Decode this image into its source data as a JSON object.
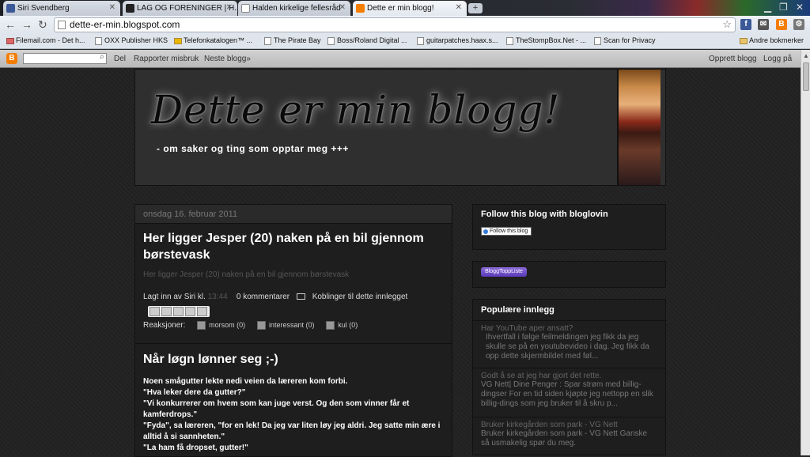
{
  "tabs": [
    {
      "label": "Siri Svendberg",
      "fav": "#3b5998"
    },
    {
      "label": "LAG OG FORENINGER | H...",
      "fav": "#222"
    },
    {
      "label": "Halden kirkelige fellesråd",
      "fav": "#fff"
    },
    {
      "label": "Dette er min blogg!",
      "fav": "#f57d00"
    }
  ],
  "address": "dette-er-min.blogspot.com",
  "bookmarks": [
    "Filemail.com - Det h...",
    "OXX Publisher HKS",
    "Telefonkatalogen™ ...",
    "The Pirate Bay",
    "Boss/Roland Digital ...",
    "guitarpatches.haax.s...",
    "TheStompBox.Net - ...",
    "Scan for Privacy"
  ],
  "other_bookmarks": "Andre bokmerker",
  "navbar": {
    "share": "Del",
    "report": "Rapporter misbruk",
    "next": "Neste blogg»",
    "create": "Opprett blogg",
    "login": "Logg på"
  },
  "header": {
    "title": "Dette er min blogg!",
    "description": "- om saker og ting som opptar meg +++"
  },
  "post": {
    "date": "onsdag 16. februar 2011",
    "title": "Her ligger Jesper (20) naken på en bil gjennom børstevask",
    "body": "Her ligger Jesper (20) naken på en bil gjennom børstevask",
    "posted_by": "Lagt inn av Siri kl.",
    "time": "13:44",
    "comments": "0 kommentarer",
    "links": "Koblinger til dette innlegget",
    "reactions_label": "Reaksjoner:",
    "reactions": [
      "morsom (0)",
      "interessant (0)",
      "kul (0)"
    ]
  },
  "post2": {
    "title": "Når løgn lønner seg ;-)",
    "lines": [
      "Noen smågutter lekte nedi veien da læreren kom forbi.",
      "\"Hva leker dere da gutter?\"",
      "\"Vi konkurrerer om hvem som kan juge verst. Og den som vinner får et kamferdrops.\"",
      "\"Fyda\", sa læreren, \"for en lek! Da jeg var liten løy jeg aldri. Jeg satte min ære i alltid å si sannheten.\"",
      "\"La ham få dropset, gutter!\""
    ]
  },
  "sidebar": {
    "follow_title": "Follow this blog with bloglovin",
    "follow_btn": "Follow this blog",
    "bloggtoppliste": "BloggToppListe",
    "popular_title": "Populære innlegg",
    "popular": [
      {
        "title": "Har YouTube aper ansatt?",
        "snippet": "Ihvertfall i følge feilmeldingen jeg fikk da jeg skulle se på en youtubevideo i dag. Jeg fikk da opp dette skjermbildet med føl..."
      },
      {
        "title": "Godt å se at jeg har gjort det rette.",
        "snippet": "VG Nett| Dine Penger : Spar strøm med billig-dingser For en tid siden kjøpte jeg nettopp en slik billig-dings som jeg bruker til å skru p..."
      },
      {
        "title": "Bruker kirkegården som park - VG Nett",
        "snippet": "Bruker kirkegården som park - VG Nett Ganske så usmakelig spør du meg."
      }
    ]
  }
}
